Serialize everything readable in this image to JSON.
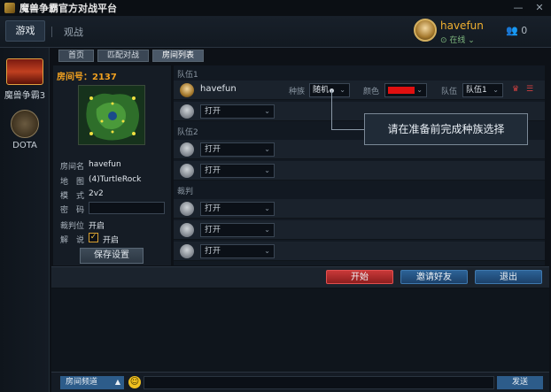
{
  "app": {
    "title": "魔兽争霸官方对战平台"
  },
  "window": {
    "minimize": "—",
    "close": "✕"
  },
  "topnav": {
    "game": "游戏",
    "watch": "观战"
  },
  "user": {
    "name": "havefun",
    "status": "⊙ 在线 ⌄",
    "friends_count": "0"
  },
  "sidebar": {
    "games": [
      {
        "label": "魔兽争霸3",
        "icon": "warcraft3-logo"
      },
      {
        "label": "DOTA",
        "icon": "dota-logo"
      }
    ]
  },
  "tabs": [
    "首页",
    "匹配对战",
    "房间列表"
  ],
  "room": {
    "id_label": "房间号：2137",
    "fields": {
      "name_label": "房间名",
      "name": "havefun",
      "map_label": "地　图",
      "map": "(4)TurtleRock",
      "mode_label": "模　式",
      "mode": "2v2",
      "password_label": "密　码",
      "referee_label": "裁判位",
      "referee": "开启",
      "commentary_label": "解　说",
      "commentary": "开启"
    },
    "save_button": "保存设置"
  },
  "slots": {
    "team1_label": "队伍1",
    "team2_label": "队伍2",
    "referee_label": "裁判",
    "host": {
      "name": "havefun",
      "race_label": "种族",
      "race": "随机",
      "color_label": "颜色",
      "team_label": "队伍",
      "team": "队伍1",
      "color": "#e01010"
    },
    "open_label": "打开"
  },
  "tooltip": {
    "text": "请在准备前完成种族选择"
  },
  "actions": {
    "start": "开始",
    "invite": "邀请好友",
    "exit": "退出"
  },
  "chat": {
    "channel": "房间频道",
    "send": "发送"
  }
}
